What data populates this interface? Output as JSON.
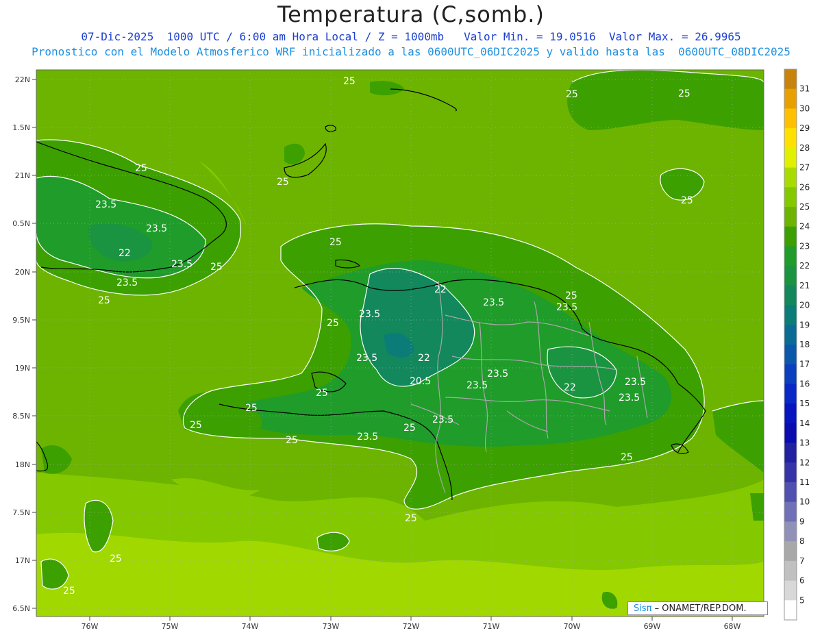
{
  "header": {
    "title": "Temperatura (C,somb.)",
    "line1": "07-Dic-2025  1000 UTC / 6:00 am Hora Local / Z = 1000mb   Valor Min. = 19.0516  Valor Max. = 26.9965",
    "line2": "Pronostico con el Modelo Atmosferico WRF inicializado a las 0600UTC_06DIC2025 y valido hasta las  0600UTC_08DIC2025"
  },
  "map": {
    "lat_labels": [
      "22N",
      "1.5N",
      "21N",
      "0.5N",
      "20N",
      "9.5N",
      "19N",
      "8.5N",
      "18N",
      "7.5N",
      "17N",
      "6.5N"
    ],
    "lon_labels": [
      "76W",
      "75W",
      "74W",
      "73W",
      "72W",
      "71W",
      "70W",
      "69W",
      "68W"
    ],
    "contour_labels": [
      "25",
      "25",
      "25",
      "25",
      "25",
      "25",
      "25",
      "25",
      "25",
      "25",
      "25",
      "25",
      "25",
      "25",
      "25",
      "25",
      "25",
      "25",
      "25",
      "25",
      "23.5",
      "23.5",
      "23.5",
      "23.5",
      "23.5",
      "23.5",
      "23.5",
      "23.5",
      "23.5",
      "23.5",
      "23.5",
      "23.5",
      "23.5",
      "23.5",
      "22",
      "22",
      "22",
      "22",
      "20.5"
    ]
  },
  "colorbar": {
    "labels": [
      "31",
      "30",
      "29",
      "28",
      "27",
      "26",
      "25",
      "24",
      "23",
      "22",
      "21",
      "20",
      "19",
      "18",
      "17",
      "16",
      "15",
      "14",
      "13",
      "12",
      "11",
      "10",
      "9",
      "8",
      "7",
      "6",
      "5"
    ],
    "colors": [
      "#c8840a",
      "#e8a000",
      "#ffc000",
      "#ffe000",
      "#e0f000",
      "#a8dc00",
      "#84c800",
      "#6cb400",
      "#3ca000",
      "#1f9c2a",
      "#1a9440",
      "#12885c",
      "#0c7c78",
      "#0a6c94",
      "#0a58ac",
      "#0a40c0",
      "#0828c8",
      "#0814c0",
      "#0a0cb0",
      "#2020a0",
      "#3434a8",
      "#5050b0",
      "#7070b8",
      "#9090b8",
      "#a8a8a8",
      "#c0c0c0",
      "#d8d8d8",
      "#ffffff"
    ]
  },
  "credit": {
    "brand": "Sisπ",
    "org": "– ONAMET/REP.DOM."
  }
}
